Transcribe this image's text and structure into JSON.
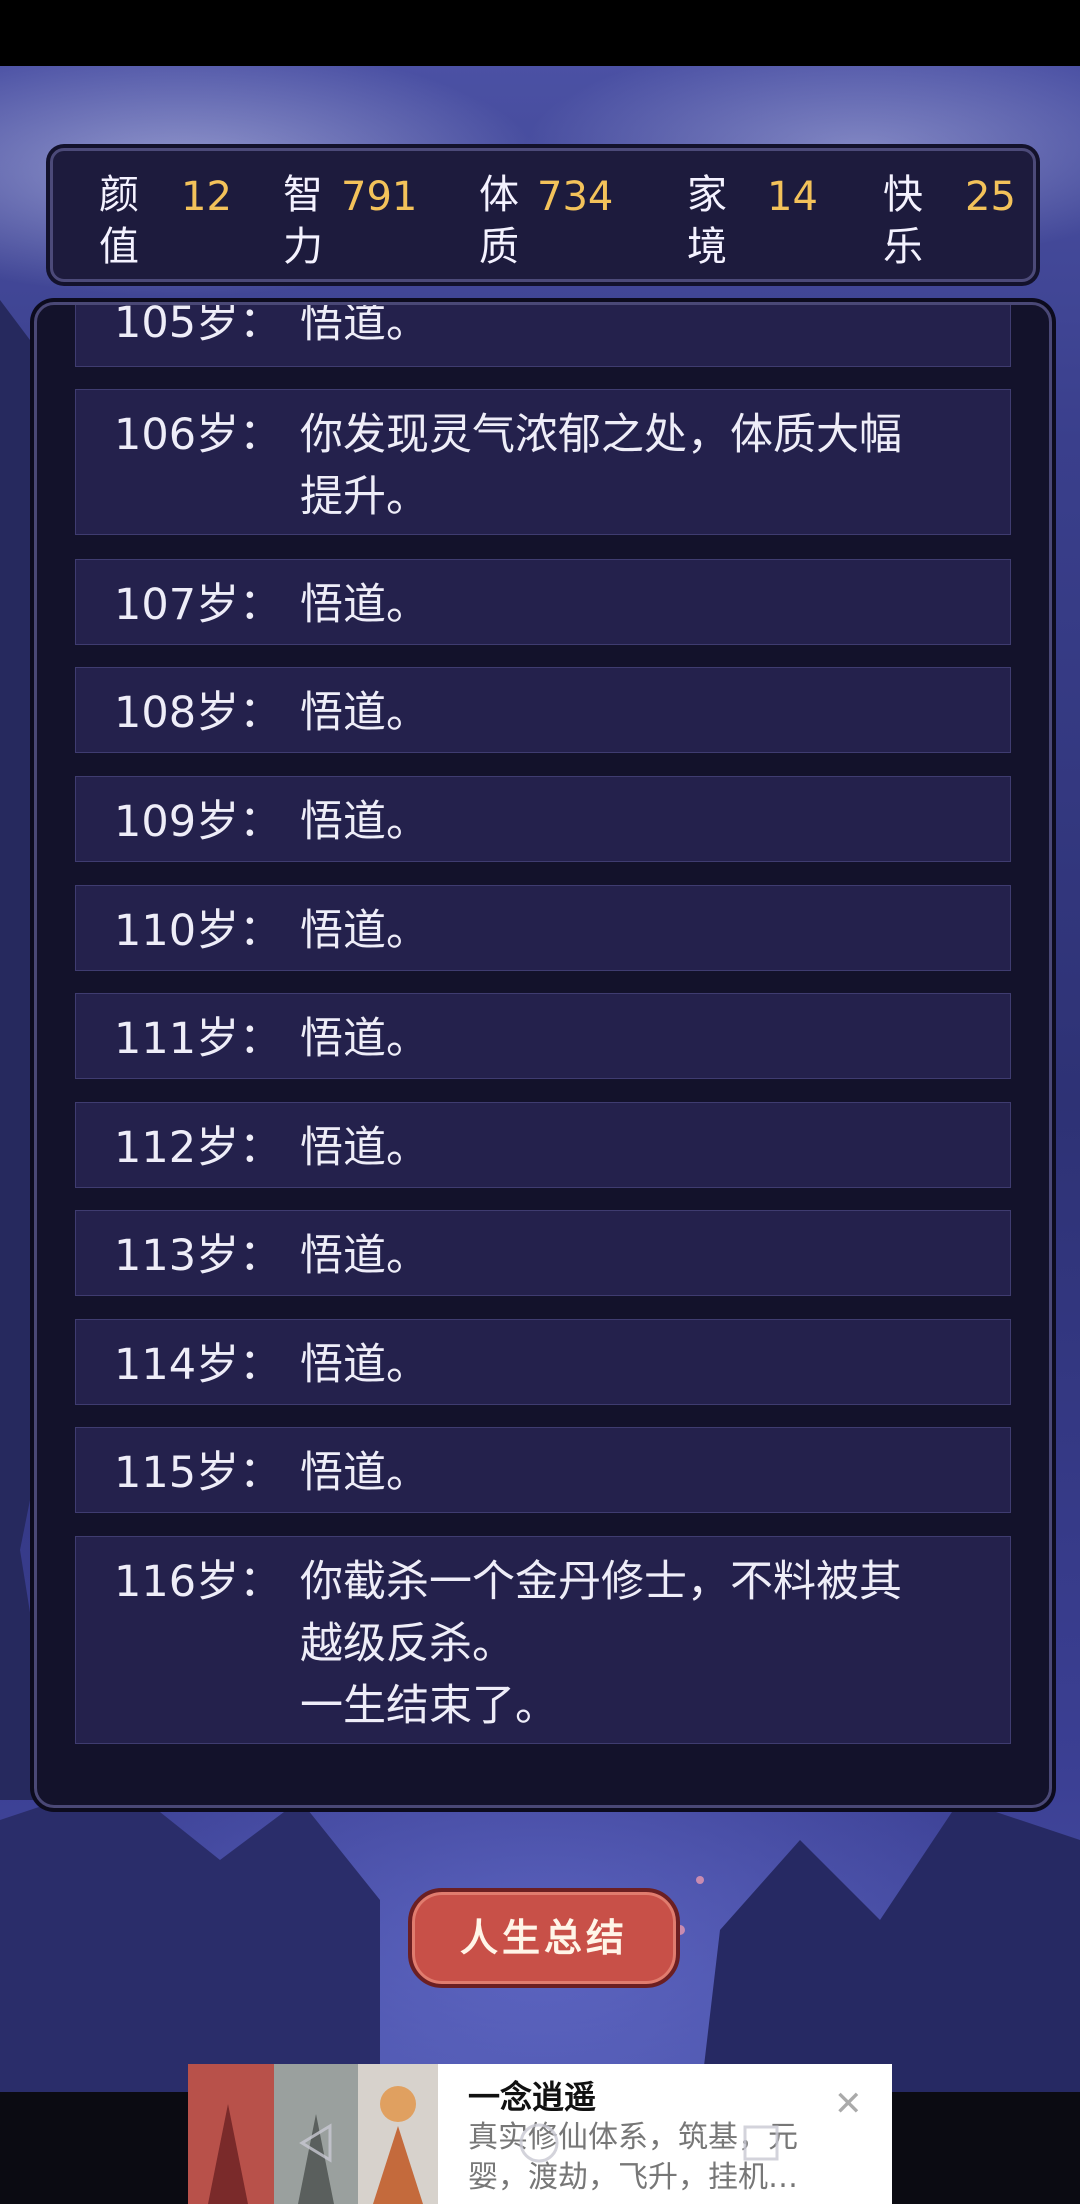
{
  "stats": [
    {
      "label": "颜值",
      "value": "12"
    },
    {
      "label": "智力",
      "value": "791"
    },
    {
      "label": "体质",
      "value": "734"
    },
    {
      "label": "家境",
      "value": "14"
    },
    {
      "label": "快乐",
      "value": "25"
    }
  ],
  "log": [
    {
      "age": "105岁：",
      "text": "悟道。"
    },
    {
      "age": "106岁：",
      "text": "你发现灵气浓郁之处，体质大幅\n提升。"
    },
    {
      "age": "107岁：",
      "text": "悟道。"
    },
    {
      "age": "108岁：",
      "text": "悟道。"
    },
    {
      "age": "109岁：",
      "text": "悟道。"
    },
    {
      "age": "110岁：",
      "text": "悟道。"
    },
    {
      "age": "111岁：",
      "text": "悟道。"
    },
    {
      "age": "112岁：",
      "text": "悟道。"
    },
    {
      "age": "113岁：",
      "text": "悟道。"
    },
    {
      "age": "114岁：",
      "text": "悟道。"
    },
    {
      "age": "115岁：",
      "text": "悟道。"
    },
    {
      "age": "116岁：",
      "text": "你截杀一个金丹修士，不料被其\n越级反杀。\n一生结束了。"
    }
  ],
  "summary_button": "人生总结",
  "ad": {
    "title": "一念逍遥",
    "description": "真实修仙体系，筑基，元\n婴，渡劫，飞升，挂机…"
  },
  "navbar_icons": [
    "back-icon",
    "home-icon",
    "recents-icon"
  ]
}
